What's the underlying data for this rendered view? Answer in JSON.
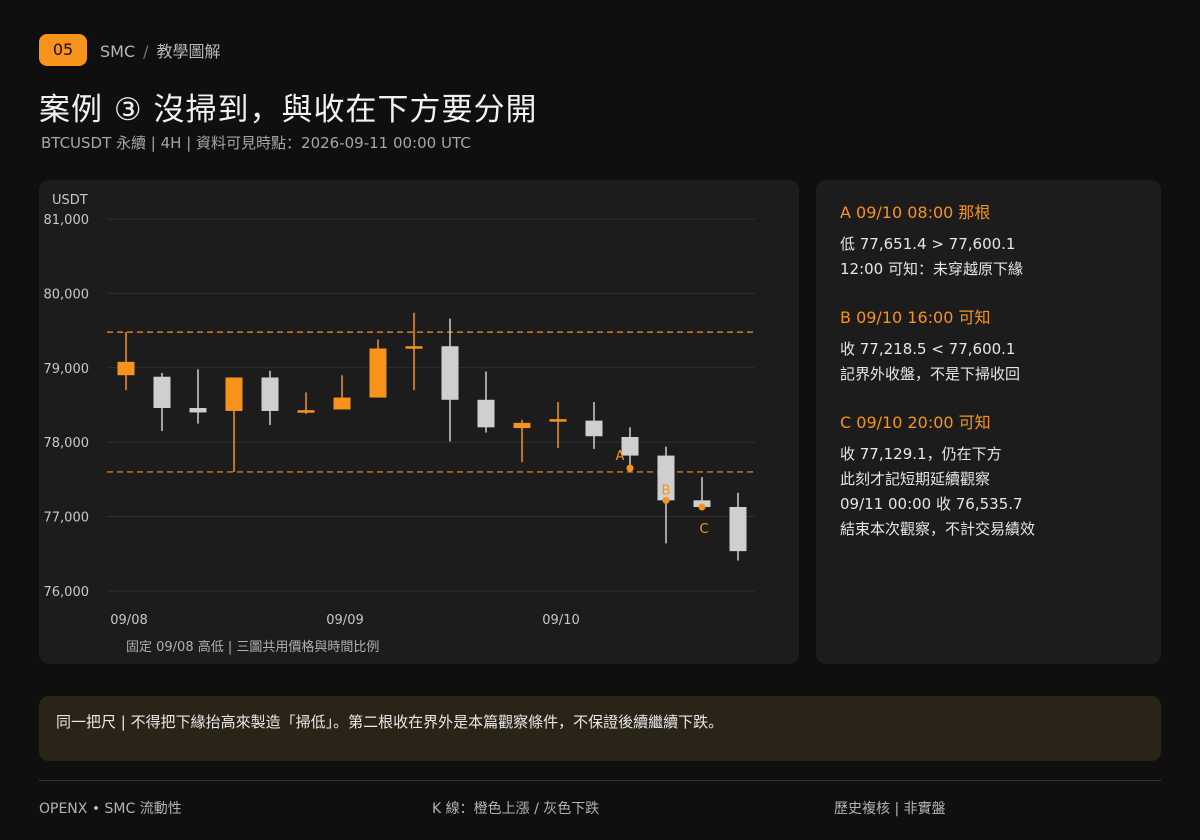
{
  "header": {
    "badge": "05",
    "breadcrumb_1": "SMC",
    "breadcrumb_sep": "/",
    "breadcrumb_2": "教學圖解",
    "title": "案例 ③  沒掃到，與收在下方要分開",
    "subtitle": "BTCUSDT 永續 | 4H | 資料可見時點：2026-09-11 00:00 UTC"
  },
  "chart_data": {
    "type": "candlestick",
    "ylabel": "USDT",
    "ylim": [
      76000,
      81000
    ],
    "yticks": [
      81000,
      80000,
      79000,
      78000,
      77000,
      76000
    ],
    "ytick_labels": [
      "81,000",
      "80,000",
      "79,000",
      "78,000",
      "77,000",
      "76,000"
    ],
    "xtick_labels": [
      {
        "label": "09/08",
        "index": 0
      },
      {
        "label": "09/09",
        "index": 6
      },
      {
        "label": "09/10",
        "index": 12
      }
    ],
    "reference_lines": [
      79480,
      77600
    ],
    "colors": {
      "up": "#f7931a",
      "down": "#cfcfcf",
      "ref": "#f7931a"
    },
    "candles": [
      {
        "o": 78900,
        "h": 79480,
        "l": 78700,
        "c": 79080
      },
      {
        "o": 78880,
        "h": 78930,
        "l": 78150,
        "c": 78460
      },
      {
        "o": 78460,
        "h": 78980,
        "l": 78250,
        "c": 78400
      },
      {
        "o": 78420,
        "h": 78870,
        "l": 77600,
        "c": 78870
      },
      {
        "o": 78870,
        "h": 78960,
        "l": 78230,
        "c": 78420
      },
      {
        "o": 78400,
        "h": 78670,
        "l": 78380,
        "c": 78430
      },
      {
        "o": 78440,
        "h": 78900,
        "l": 78440,
        "c": 78600
      },
      {
        "o": 78600,
        "h": 79380,
        "l": 78600,
        "c": 79260
      },
      {
        "o": 79260,
        "h": 79740,
        "l": 78700,
        "c": 79290
      },
      {
        "o": 79290,
        "h": 79660,
        "l": 78010,
        "c": 78570
      },
      {
        "o": 78570,
        "h": 78950,
        "l": 78130,
        "c": 78200
      },
      {
        "o": 78190,
        "h": 78300,
        "l": 77730,
        "c": 78260
      },
      {
        "o": 78280,
        "h": 78540,
        "l": 77920,
        "c": 78310
      },
      {
        "o": 78290,
        "h": 78540,
        "l": 77910,
        "c": 78080
      },
      {
        "o": 78070,
        "h": 78200,
        "l": 77651.4,
        "c": 77820
      },
      {
        "o": 77820,
        "h": 77940,
        "l": 76640,
        "c": 77218.5
      },
      {
        "o": 77218.5,
        "h": 77530,
        "l": 77110,
        "c": 77129.1
      },
      {
        "o": 77129.1,
        "h": 77320,
        "l": 76410,
        "c": 76535.7
      }
    ],
    "markers": [
      {
        "label": "A",
        "index": 14,
        "price": 77651.4
      },
      {
        "label": "B",
        "index": 15,
        "price": 77218.5
      },
      {
        "label": "C",
        "index": 16,
        "price": 77129.1
      }
    ],
    "caption": "固定 09/08 高低 | 三圖共用價格與時間比例"
  },
  "notes": [
    {
      "head": "A  09/10 08:00 那根",
      "lines": [
        "低 77,651.4 > 77,600.1",
        "12:00 可知：未穿越原下緣"
      ]
    },
    {
      "head": "B  09/10 16:00 可知",
      "lines": [
        "收 77,218.5 < 77,600.1",
        "記界外收盤，不是下掃收回"
      ]
    },
    {
      "head": "C  09/10 20:00 可知",
      "lines": [
        "收 77,129.1，仍在下方",
        "此刻才記短期延續觀察",
        "09/11 00:00 收 76,535.7",
        "結束本次觀察，不計交易績效"
      ]
    }
  ],
  "footer_note": "同一把尺 | 不得把下緣抬高來製造「掃低」。第二根收在界外是本篇觀察條件，不保證後續繼續下跌。",
  "footer": {
    "left": "OPENX  •  SMC 流動性",
    "middle": "K 線：橙色上漲 / 灰色下跌",
    "right": "歷史複核 | 非實盤"
  }
}
